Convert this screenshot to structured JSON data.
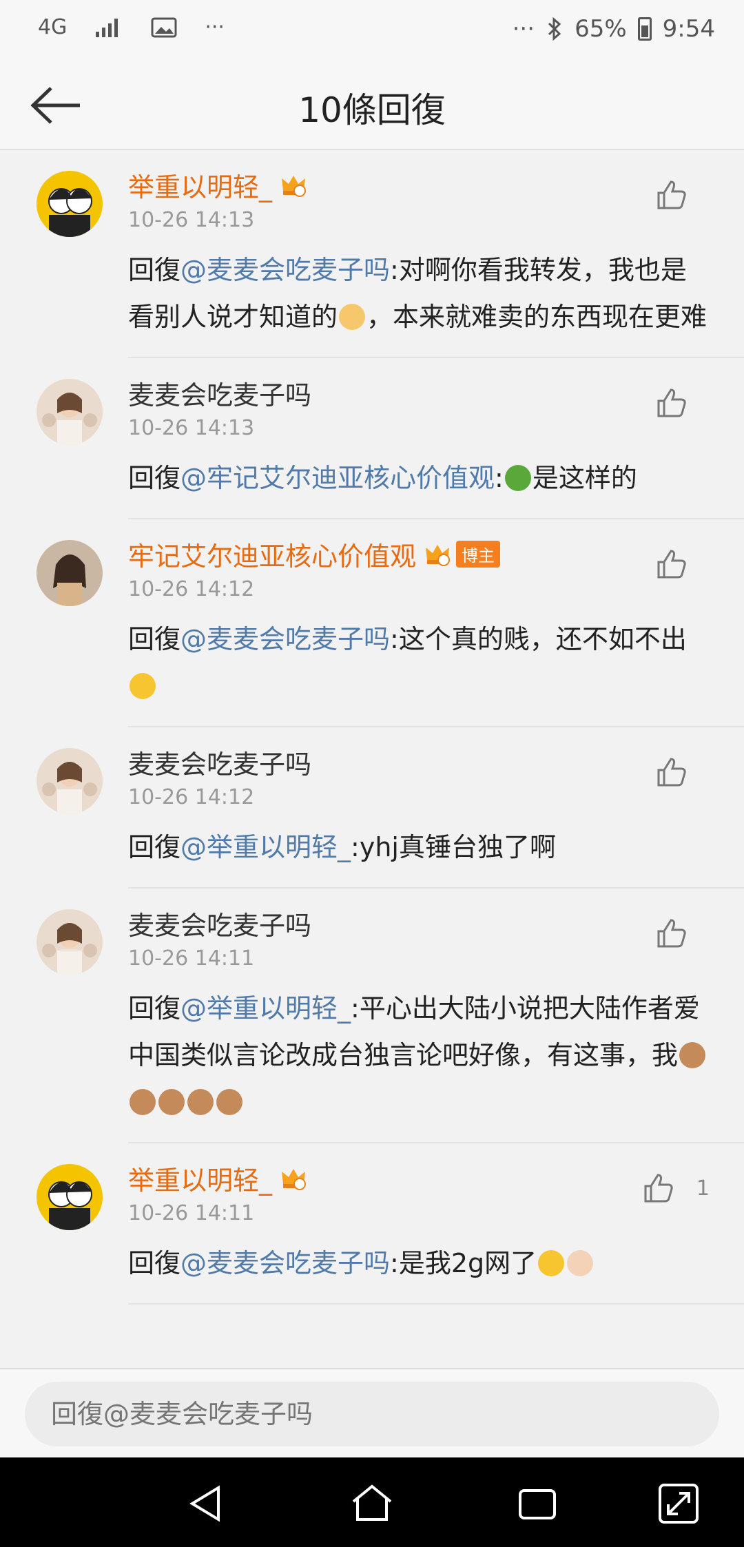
{
  "status": {
    "network": "4G",
    "battery": "65%",
    "time": "9:54",
    "dots": "···"
  },
  "header": {
    "title": "10條回復"
  },
  "comments": [
    {
      "name": "举重以明轻_",
      "time": "10-26 14:13",
      "prefix": "回復",
      "mention": "@麦麦会吃麦子吗",
      "text1": ":对啊你看我转发，我也是看别人说才知道的",
      "text2": "，本来就难卖的东西现在更难",
      "like_count": ""
    },
    {
      "name": "麦麦会吃麦子吗",
      "time": "10-26 14:13",
      "prefix": "回復",
      "mention": "@牢记艾尔迪亚核心价值观",
      "text1": ":",
      "text2": "是这样的",
      "like_count": ""
    },
    {
      "name": "牢记艾尔迪亚核心价值观",
      "badge": "博主",
      "time": "10-26 14:12",
      "prefix": "回復",
      "mention": "@麦麦会吃麦子吗",
      "text1": ":这个真的贱，还不如不出",
      "text2": "",
      "like_count": ""
    },
    {
      "name": "麦麦会吃麦子吗",
      "time": "10-26 14:12",
      "prefix": "回復",
      "mention": "@举重以明轻_",
      "text1": ":yhj真锤台独了啊",
      "text2": "",
      "like_count": ""
    },
    {
      "name": "麦麦会吃麦子吗",
      "time": "10-26 14:11",
      "prefix": "回復",
      "mention": "@举重以明轻_",
      "text1": ":平心出大陆小说把大陆作者爱中国类似言论改成台独言论吧好像，有这事，我",
      "text2": "",
      "like_count": ""
    },
    {
      "name": "举重以明轻_",
      "time": "10-26 14:11",
      "prefix": "回復",
      "mention": "@麦麦会吃麦子吗",
      "text1": ":是我2g网了",
      "text2": "",
      "like_count": "1"
    }
  ],
  "reply": {
    "placeholder": "回復@麦麦会吃麦子吗"
  },
  "colors": {
    "vip_name": "#e86b10",
    "mention": "#4f7aa9",
    "badge": "#f57f1e"
  }
}
